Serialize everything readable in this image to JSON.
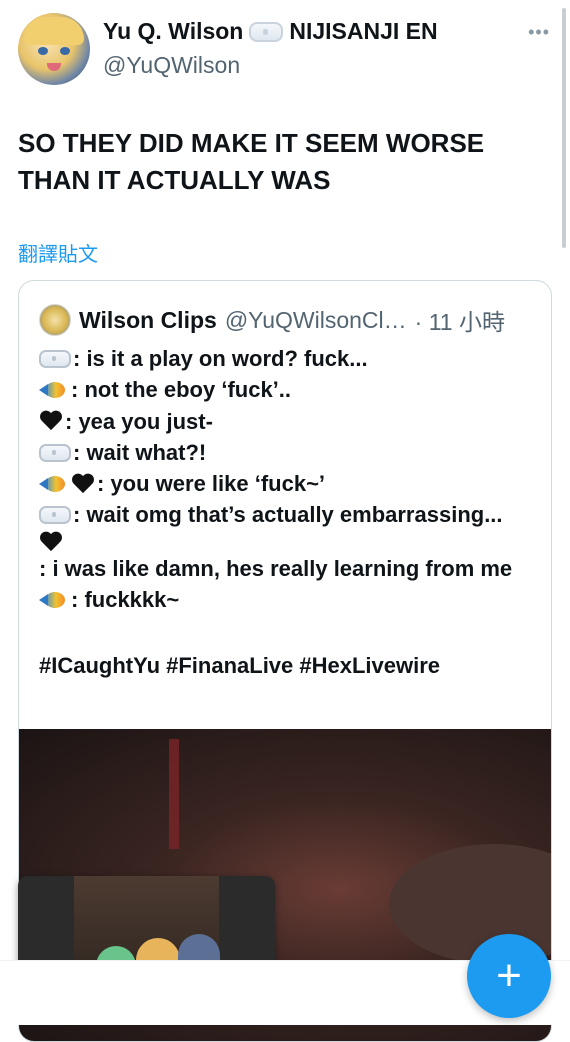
{
  "tweet": {
    "author_name": "Yu Q. Wilson",
    "author_affiliation": "NIJISANJI EN",
    "author_handle": "@YuQWilson",
    "text": "SO THEY DID MAKE IT SEEM WORSE THAN IT ACTUALLY WAS",
    "translate_label": "翻譯貼文",
    "more_icon": "more-horizontal-icon"
  },
  "quote": {
    "name": "Wilson Clips",
    "handle": "@YuQWilsonCl…",
    "time": "· 11 小時",
    "lines": [
      {
        "icons": [
          "goggles"
        ],
        "text": ": is it a play on word? fuck..."
      },
      {
        "icons": [
          "fish"
        ],
        "text": ": not the eboy ‘fuck’.."
      },
      {
        "icons": [
          "black-heart"
        ],
        "text": ": yea you just-"
      },
      {
        "icons": [
          "goggles"
        ],
        "text": ": wait what?!"
      },
      {
        "icons": [
          "fish",
          "black-heart"
        ],
        "text": ": you were like ‘fuck~’"
      },
      {
        "icons": [
          "goggles"
        ],
        "text": ": wait omg that’s actually embarrassing..."
      },
      {
        "icons": [
          "black-heart"
        ],
        "text": ": i was like damn, hes really learning from me"
      },
      {
        "icons": [
          "fish"
        ],
        "text": ": fuckkkk~"
      }
    ],
    "hashtags": "#ICaughtYu #FinanaLive #HexLivewire"
  },
  "compose_button": {
    "label": "+",
    "icon": "plus-icon",
    "color": "#1d9bf0"
  },
  "colors": {
    "accent": "#1d9bf0",
    "secondary_text": "#536471"
  }
}
